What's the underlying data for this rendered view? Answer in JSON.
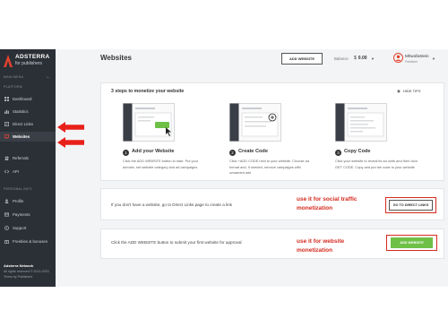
{
  "colors": {
    "sidebar_bg": "#2b2f36",
    "brand_red": "#e2432e",
    "annotation_red": "#d42a1e",
    "primary_green": "#6fc046"
  },
  "sidebar": {
    "brand": {
      "name": "ADSTERRA",
      "tagline": "for publishers"
    },
    "main_menu_label": "MAIN MENU",
    "platform_label": "PLATFORM",
    "items": [
      {
        "label": "Dashboard",
        "icon": "dashboard-icon"
      },
      {
        "label": "Statistics",
        "icon": "bar-chart-icon"
      },
      {
        "label": "Direct Links",
        "icon": "link-icon"
      },
      {
        "label": "Websites",
        "icon": "monitor-icon",
        "active": true
      },
      {
        "label": "Referrals",
        "icon": "people-icon"
      },
      {
        "label": "API",
        "icon": "code-icon"
      }
    ],
    "personal_label": "PERSONAL INFO",
    "personal_items": [
      {
        "label": "Profile",
        "icon": "user-icon"
      },
      {
        "label": "Payments",
        "icon": "card-icon"
      },
      {
        "label": "Support",
        "icon": "support-icon"
      },
      {
        "label": "Freebies & bonuses",
        "icon": "gift-icon"
      }
    ],
    "footer": {
      "company": "Adsterra Network",
      "rights": "All rights reserved © 2013-2023",
      "made_by": "Terms by Publishers"
    }
  },
  "header": {
    "title": "Websites",
    "add_button": "ADD WEBSITE",
    "balance_label": "Balance",
    "balance_currency": "$",
    "balance_value": "0.00",
    "user_name": "MhwofaStein",
    "user_role": "Publisher"
  },
  "steps_card": {
    "title": "3 steps to monetize your website",
    "hide_tips": "HIDE TIPS",
    "steps": [
      {
        "num": "1",
        "title": "Add your Website",
        "desc": "Click the ADD WEBSITE button to start. Put your domain, set website category and ad campaigns"
      },
      {
        "num": "2",
        "title": "Create Code",
        "desc": "Click +ADD CODE next to your website. Choose ad format and, if needed, remove campaigns with unwanted ads"
      },
      {
        "num": "3",
        "title": "Copy Code",
        "desc": "Click your website to reveal its ad units and then click GET CODE. Copy and put the code to your website"
      }
    ]
  },
  "direct_links_row": {
    "text": "If you don't have a website, go to Direct Links page to create a link",
    "annotation": "use it for social traffic monetization",
    "button": "GO TO DIRECT LINKS"
  },
  "add_website_row": {
    "text": "Click the ADD WEBSITE button to submit your first website for approval",
    "annotation": "use it for website monetization",
    "button": "ADD WEBSITE"
  }
}
